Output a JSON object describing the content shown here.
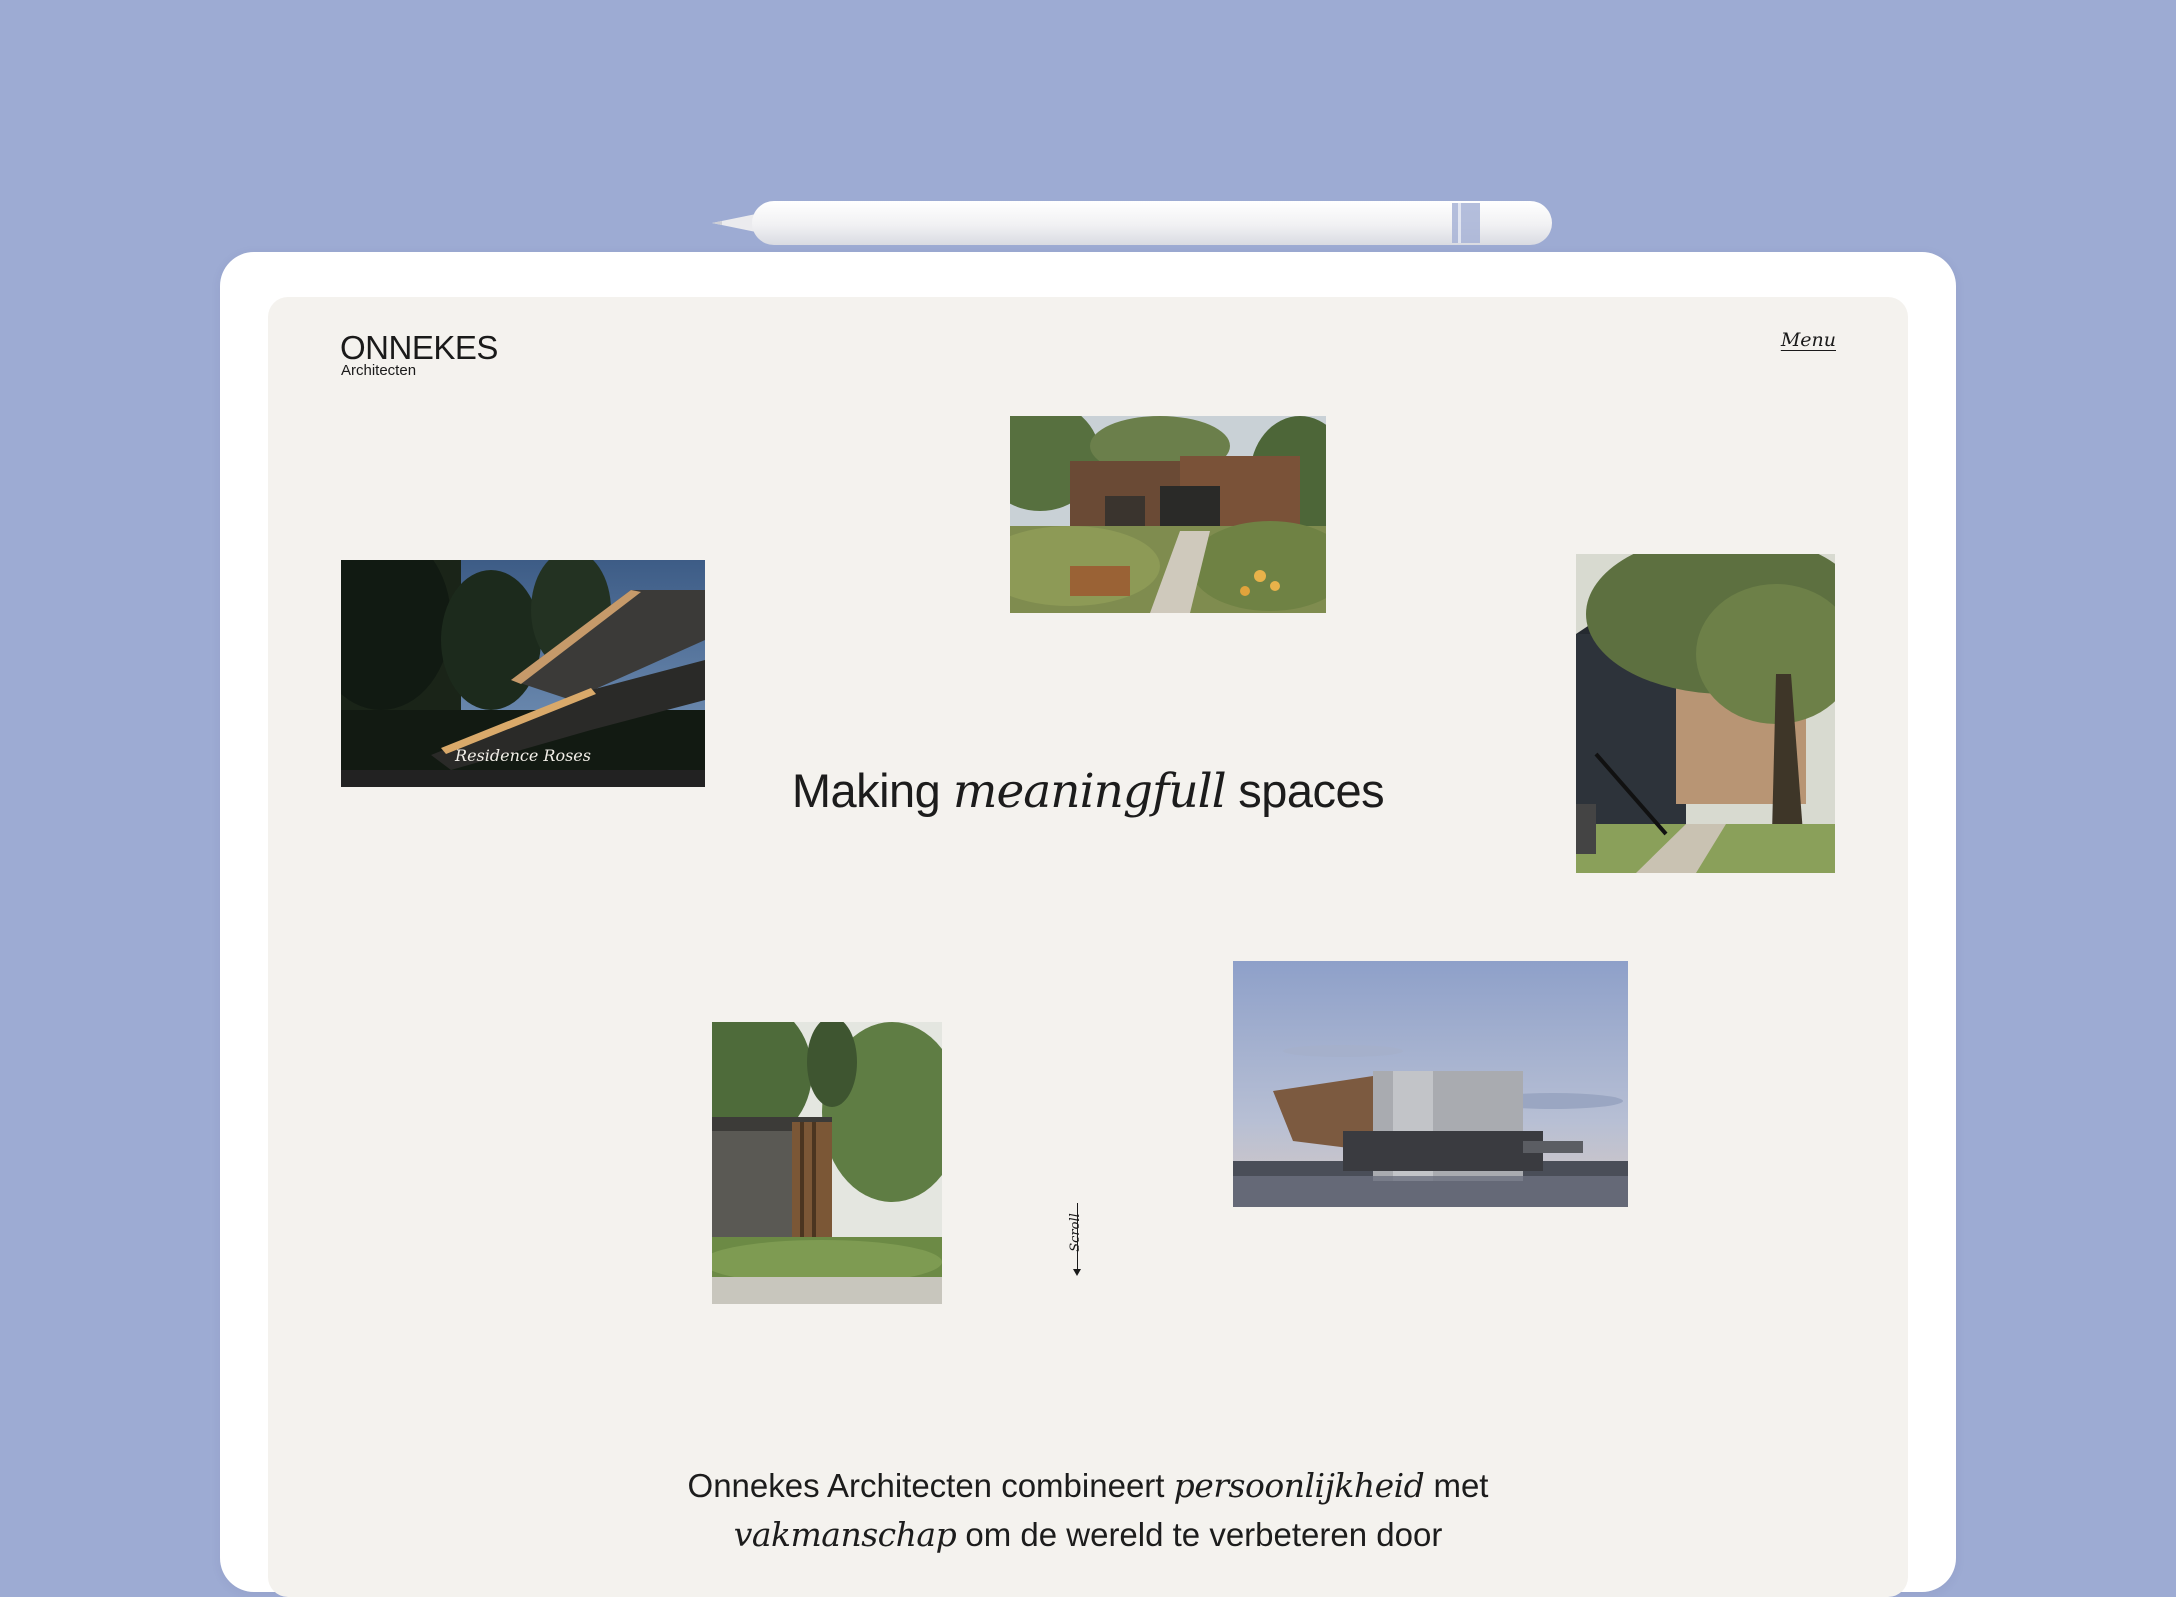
{
  "header": {
    "logo_name": "ONNEKES",
    "logo_sub": "Architecten",
    "menu_label": "Menu"
  },
  "hero": {
    "before": "Making",
    "emphasis": "meaningfull",
    "after": "spaces"
  },
  "projects": [
    {
      "caption": "Residence Roses"
    }
  ],
  "scroll_label": "Scroll",
  "intro": {
    "line1_before": "Onnekes Architecten combineert",
    "line1_emphasis": "persoonlijkheid",
    "line1_after": "met",
    "line2_emphasis": "vakmanschap",
    "line2_after": "om de wereld te verbeteren door"
  },
  "colors": {
    "background": "#9dabd3",
    "tablet_frame": "#ffffff",
    "page_background": "#f4f2ee",
    "text": "#1c1c1c"
  }
}
